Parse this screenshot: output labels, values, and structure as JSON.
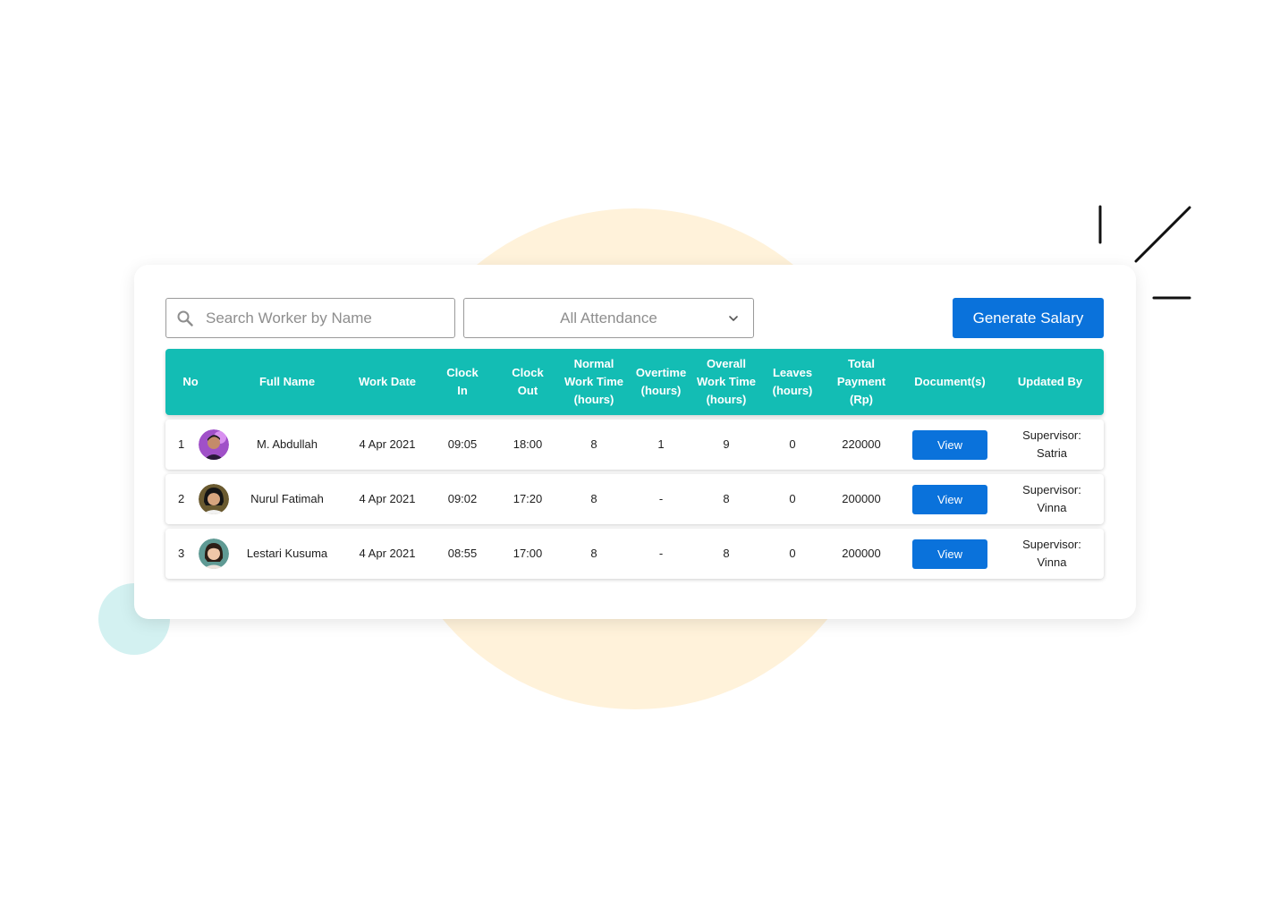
{
  "toolbar": {
    "search_placeholder": "Search Worker by Name",
    "attendance_filter": "All Attendance",
    "generate_label": "Generate Salary"
  },
  "colors": {
    "accent": "#0a72db",
    "header_teal": "#13bdb4",
    "bg_circle": "#fff2da",
    "teal_dot": "#d3f1f1"
  },
  "icons": {
    "search": "search-icon",
    "dropdown": "chevron-down-icon"
  },
  "table": {
    "headers": [
      "No",
      "Full Name",
      "Work Date",
      "Clock\nIn",
      "Clock\nOut",
      "Normal\nWork Time\n(hours)",
      "Overtime\n(hours)",
      "Overall\nWork Time\n(hours)",
      "Leaves\n(hours)",
      "Total\nPayment\n(Rp)",
      "Document(s)",
      "Updated By"
    ],
    "rows": [
      {
        "no": "1",
        "name": "M. Abdullah",
        "date": "4 Apr 2021",
        "clock_in": "09:05",
        "clock_out": "18:00",
        "normal": "8",
        "overtime": "1",
        "overall": "9",
        "leaves": "0",
        "payment": "220000",
        "document": "View",
        "updated_line1": "Supervisor:",
        "updated_line2": "Satria"
      },
      {
        "no": "2",
        "name": "Nurul Fatimah",
        "date": "4 Apr 2021",
        "clock_in": "09:02",
        "clock_out": "17:20",
        "normal": "8",
        "overtime": "-",
        "overall": "8",
        "leaves": "0",
        "payment": "200000",
        "document": "View",
        "updated_line1": "Supervisor:",
        "updated_line2": "Vinna"
      },
      {
        "no": "3",
        "name": "Lestari Kusuma",
        "date": "4 Apr 2021",
        "clock_in": "08:55",
        "clock_out": "17:00",
        "normal": "8",
        "overtime": "-",
        "overall": "8",
        "leaves": "0",
        "payment": "200000",
        "document": "View",
        "updated_line1": "Supervisor:",
        "updated_line2": "Vinna"
      }
    ]
  }
}
